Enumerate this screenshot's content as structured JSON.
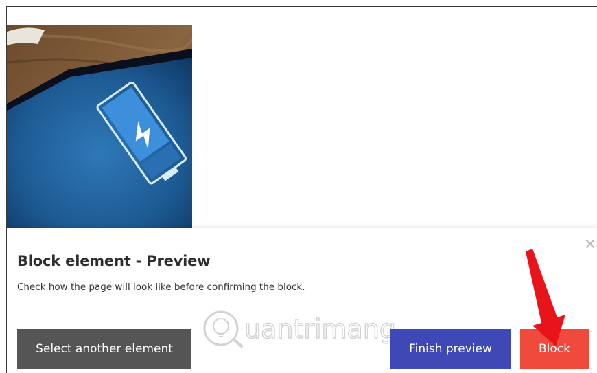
{
  "preview_panel": {
    "title": "Block element - Preview",
    "description": "Check how the page will look like before confirming the block.",
    "close_icon": "close-icon",
    "close_glyph": "✕"
  },
  "buttons": {
    "select_another": "Select another element",
    "finish_preview": "Finish preview",
    "block": "Block"
  },
  "hero_image": {
    "subject": "tablet showing battery charging icon on wooden surface",
    "icon": "battery-charging-icon"
  },
  "watermark": {
    "text": "uantrimang",
    "letter": "Q"
  },
  "annotation": {
    "icon": "red-arrow-pointing-to-block-button"
  },
  "colors": {
    "select_button": "#555555",
    "finish_button": "#3f49b5",
    "block_button": "#f04a3c",
    "arrow": "#e8141a",
    "title_text": "#2e2e2e",
    "close_icon": "#b8b8b8"
  }
}
